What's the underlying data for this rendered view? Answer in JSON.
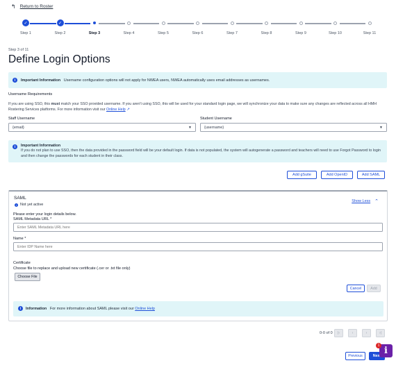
{
  "nav": {
    "back_label": "Return to Roster",
    "back_icon": "arrow-return-icon"
  },
  "stepper": {
    "steps": [
      {
        "label": "Step 1",
        "state": "done"
      },
      {
        "label": "Step 2",
        "state": "done"
      },
      {
        "label": "Step 3",
        "state": "current"
      },
      {
        "label": "Step 4",
        "state": "todo"
      },
      {
        "label": "Step 5",
        "state": "todo"
      },
      {
        "label": "Step 6",
        "state": "todo"
      },
      {
        "label": "Step 7",
        "state": "todo"
      },
      {
        "label": "Step 8",
        "state": "todo"
      },
      {
        "label": "Step 9",
        "state": "todo"
      },
      {
        "label": "Step 10",
        "state": "todo"
      },
      {
        "label": "Step 11",
        "state": "todo"
      }
    ]
  },
  "header": {
    "step_of": "Step 3 of 11",
    "title": "Define Login Options"
  },
  "info_important": {
    "title": "Important Information",
    "text": "Username configuration options will not apply for NWEA users, NWEA automatically uses email addresses as usernames."
  },
  "username_requirements": {
    "heading": "Username Requirements",
    "para_part1": "If you are using SSO, this ",
    "para_bold": "must",
    "para_part2": " match your SSO provided username. If you aren't using SSO, this will be used for your standard login page, we will synchronize your data to make sure any changes are reflected across all HMH Rostering Services platforms. For more information visit our ",
    "link": "Online Help"
  },
  "staff_username": {
    "label": "Staff Username",
    "value": "{email}"
  },
  "student_username": {
    "label": "Student Username",
    "value": "{username}"
  },
  "info_password": {
    "title": "Important Information",
    "text": "If you do not plan to use SSO, then the data provided in the password field will be your default login. If data is not populated, the system will autogenerate a password and teachers will need to use Forgot Password to login and then change the passwords for each student in their class."
  },
  "provider_buttons": {
    "gsuite": "Add gSuite",
    "openid": "Add OpenID",
    "saml": "Add SAML"
  },
  "saml": {
    "title": "SAML",
    "status": "Not yet active",
    "show_less": "Show Less",
    "intro": "Please enter your login details below.",
    "metadata_label": "SAML Metadata URL *",
    "metadata_placeholder": "Enter SAML Metadata URL here",
    "name_label": "Name *",
    "name_placeholder": "Enter IDP Name here",
    "cert_label": "Certificate",
    "cert_hint": "Choose file to replace and upload new certificate (.cer or .txt file only)",
    "choose_file": "Choose File",
    "cancel": "Cancel",
    "add": "Add",
    "info_title": "Information",
    "info_text": "For more information about SAML please visit our ",
    "info_link": "Online Help"
  },
  "pagination": {
    "count": "0-0 of 0"
  },
  "footer": {
    "previous": "Previous",
    "next": "Next",
    "help_badge": "1",
    "help_icon": "i"
  }
}
